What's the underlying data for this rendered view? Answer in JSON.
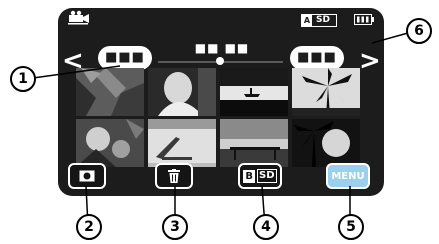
{
  "status_bar": {
    "camera_icon": "video-camera-icon",
    "media_badge": {
      "prefix": "A",
      "label": "SD"
    },
    "battery_icon": "battery-icon"
  },
  "navigation": {
    "prev_arrow": "<",
    "next_arrow": ">",
    "left_group_label": "■■■",
    "right_group_label": "■■■",
    "center_label": "■■ ■■"
  },
  "thumbnails": [
    "palm-trees-thumbnail",
    "person-portrait-thumbnail",
    "canoe-lake-thumbnail",
    "palm-silhouette-thumbnail",
    "flower-leaves-thumbnail",
    "beach-chair-thumbnail",
    "pier-sunset-thumbnail",
    "dark-palm-thumbnail"
  ],
  "buttons": {
    "record_icon": "record-icon",
    "delete_icon": "trash-icon",
    "media_b": "B",
    "media_sd": "SD",
    "menu_label": "MENU"
  },
  "callouts": [
    "1",
    "2",
    "3",
    "4",
    "5",
    "6"
  ],
  "colors": {
    "screen_bg": "#1c1c1c",
    "menu_bg": "#9ad0ee",
    "pill_bg": "#ffffff"
  }
}
